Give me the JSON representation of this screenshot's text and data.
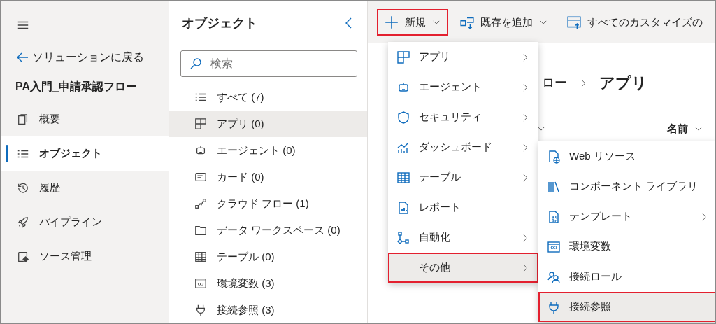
{
  "nav": {
    "back": "ソリューションに戻る",
    "solution": "PA入門_申請承認フロー",
    "items": [
      {
        "label": "概要",
        "selected": false
      },
      {
        "label": "オブジェクト",
        "selected": true
      },
      {
        "label": "履歴",
        "selected": false
      },
      {
        "label": "パイプライン",
        "selected": false
      },
      {
        "label": "ソース管理",
        "selected": false
      }
    ]
  },
  "objects": {
    "title": "オブジェクト",
    "search": {
      "placeholder": "検索"
    },
    "items": [
      {
        "label": "すべて (7)",
        "selected": false
      },
      {
        "label": "アプリ (0)",
        "selected": true
      },
      {
        "label": "エージェント (0)",
        "selected": false
      },
      {
        "label": "カード (0)",
        "selected": false
      },
      {
        "label": "クラウド フロー (1)",
        "selected": false
      },
      {
        "label": "データ ワークスペース (0)",
        "selected": false
      },
      {
        "label": "テーブル (0)",
        "selected": false
      },
      {
        "label": "環境変数 (3)",
        "selected": false
      },
      {
        "label": "接続参照 (3)",
        "selected": false
      }
    ]
  },
  "toolbar": [
    {
      "label": "新規",
      "dropdown": true,
      "highlighted": true
    },
    {
      "label": "既存を追加",
      "dropdown": true,
      "highlighted": false
    },
    {
      "label": "すべてのカスタマイズの",
      "dropdown": false,
      "highlighted": false
    }
  ],
  "breadcrumb": [
    "ロー",
    "アプリ"
  ],
  "column": "名前",
  "menu": [
    {
      "label": "アプリ",
      "submenu": true,
      "selected": false,
      "highlighted": false
    },
    {
      "label": "エージェント",
      "submenu": true,
      "selected": false,
      "highlighted": false
    },
    {
      "label": "セキュリティ",
      "submenu": true,
      "selected": false,
      "highlighted": false
    },
    {
      "label": "ダッシュボード",
      "submenu": true,
      "selected": false,
      "highlighted": false
    },
    {
      "label": "テーブル",
      "submenu": true,
      "selected": false,
      "highlighted": false
    },
    {
      "label": "レポート",
      "submenu": false,
      "selected": false,
      "highlighted": false
    },
    {
      "label": "自動化",
      "submenu": true,
      "selected": false,
      "highlighted": false
    },
    {
      "label": "その他",
      "submenu": true,
      "selected": true,
      "highlighted": true
    }
  ],
  "submenu": [
    {
      "label": "Web リソース",
      "submenu": false,
      "selected": false,
      "highlighted": false
    },
    {
      "label": "コンポーネント ライブラリ",
      "submenu": false,
      "selected": false,
      "highlighted": false
    },
    {
      "label": "テンプレート",
      "submenu": true,
      "selected": false,
      "highlighted": false
    },
    {
      "label": "環境変数",
      "submenu": false,
      "selected": false,
      "highlighted": false
    },
    {
      "label": "接続ロール",
      "submenu": false,
      "selected": false,
      "highlighted": false
    },
    {
      "label": "接続参照",
      "submenu": false,
      "selected": true,
      "highlighted": true
    }
  ]
}
